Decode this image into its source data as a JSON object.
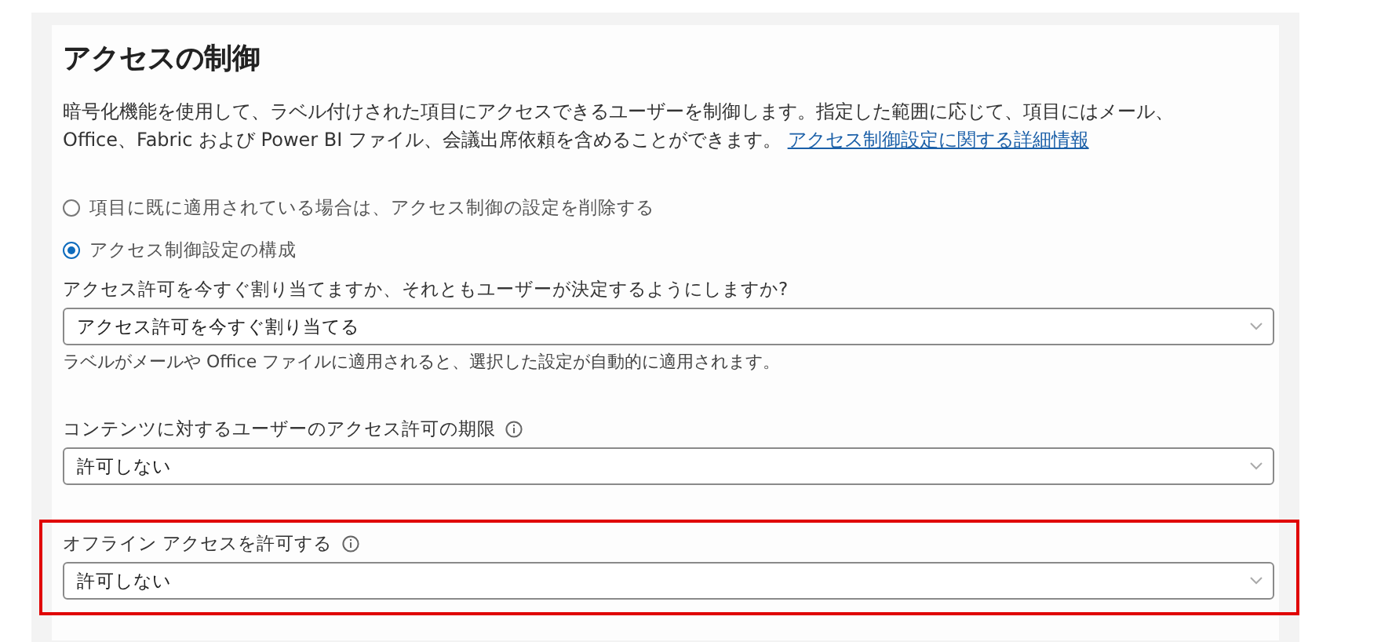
{
  "title": "アクセスの制御",
  "description": {
    "text": "暗号化機能を使用して、ラベル付けされた項目にアクセスできるユーザーを制御します。指定した範囲に応じて、項目にはメール、Office、Fabric および Power BI ファイル、会議出席依頼を含めることができます。",
    "link": "アクセス制御設定に関する詳細情報"
  },
  "options": [
    {
      "label": "項目に既に適用されている場合は、アクセス制御の設定を削除する",
      "selected": false
    },
    {
      "label": "アクセス制御設定の構成",
      "selected": true
    }
  ],
  "fields": [
    {
      "label": "アクセス許可を今すぐ割り当てますか、それともユーザーが決定するようにしますか?",
      "info": false,
      "value": "アクセス許可を今すぐ割り当てる",
      "hint": "ラベルがメールや Office ファイルに適用されると、選択した設定が自動的に適用されます。",
      "highlighted": false
    },
    {
      "label": "コンテンツに対するユーザーのアクセス許可の期限",
      "info": true,
      "value": "許可しない",
      "highlighted": false
    },
    {
      "label": "オフライン アクセスを許可する",
      "info": true,
      "value": "許可しない",
      "highlighted": true
    }
  ]
}
